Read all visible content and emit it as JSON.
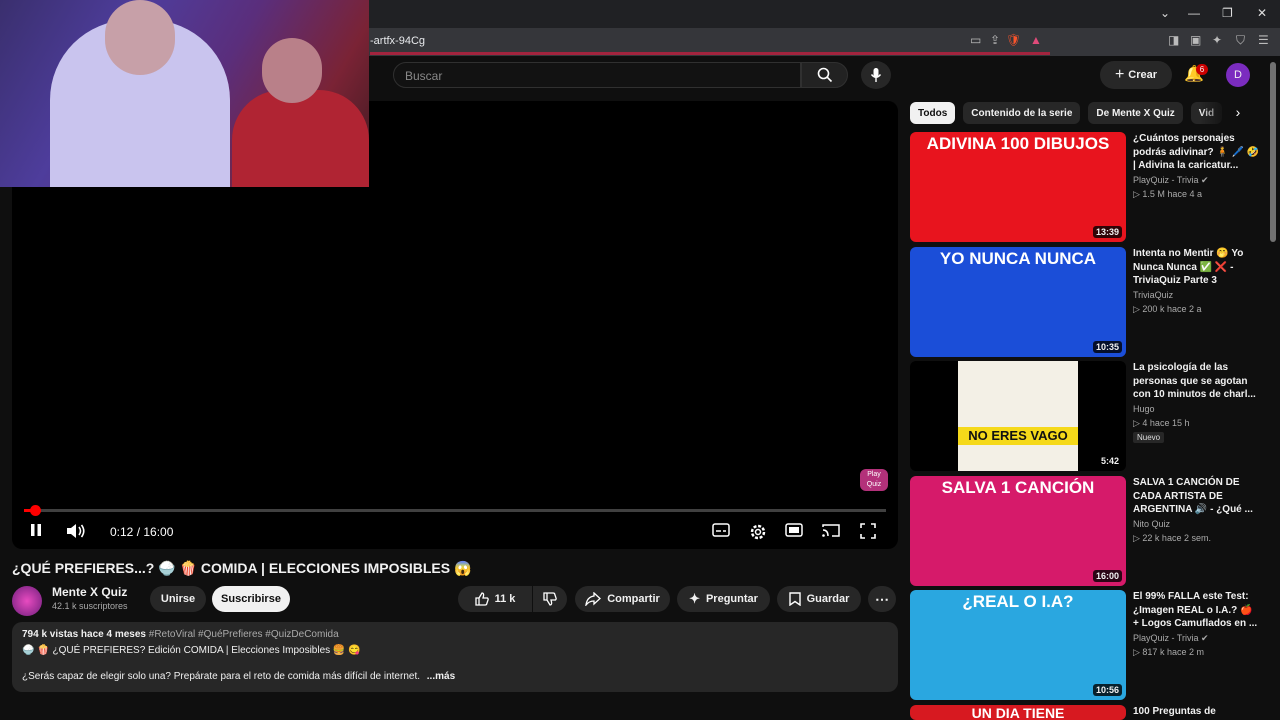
{
  "browser": {
    "url_fragment": "-artfx-94Cg"
  },
  "header": {
    "search_placeholder": "Buscar",
    "create_label": "Crear",
    "notif_count": "6",
    "avatar_letter": "D"
  },
  "player": {
    "time": "0:12 / 16:00",
    "progress_fraction": 0.0125,
    "watermark": "Play Quiz"
  },
  "video": {
    "title": "¿QUÉ PREFIERES...? 🍚 🍿 COMIDA | ELECCIONES IMPOSIBLES 😱",
    "channel": "Mente X Quiz",
    "subscribers": "42.1 k suscriptores",
    "join_label": "Unirse",
    "subscribe_label": "Suscribirse",
    "likes": "11 k",
    "share_label": "Compartir",
    "ask_label": "Preguntar",
    "save_label": "Guardar"
  },
  "description": {
    "views_date": "794 k vistas  hace 4 meses",
    "tags": "#RetoViral #QuéPrefieres #QuizDeComida",
    "line2": "🍚 🍿 ¿QUÉ PREFIERES? Edición COMIDA | Elecciones Imposibles 🍔 😋",
    "line3": "¿Serás capaz de elegir solo una? Prepárate para el reto de comida más difícil de internet.",
    "more": "...más"
  },
  "chips": [
    "Todos",
    "Contenido de la serie",
    "De Mente X Quiz",
    "Vid"
  ],
  "recommendations": [
    {
      "thumb_text": "ADIVINA 100 DIBUJOS",
      "thumb_color": "#e8141e",
      "duration": "13:39",
      "title": "¿Cuántos personajes podrás adivinar? 🧍 🖊️ 🤣 | Adivina la caricatur...",
      "channel": "PlayQuiz - Trivia ✔",
      "meta": "▷ 1.5 M   hace 4 a"
    },
    {
      "thumb_text": "YO NUNCA NUNCA",
      "thumb_color": "#1b4ed8",
      "duration": "10:35",
      "title": "Intenta no Mentir 🤭 Yo Nunca Nunca ✅ ❌ - TriviaQuiz Parte 3",
      "channel": "TriviaQuiz",
      "meta": "▷ 200 k   hace 2 a"
    },
    {
      "thumb_text": "NO ERES VAGO",
      "thumb_color": "#f3f0e6",
      "duration": "5:42",
      "title": "La psicología de las personas que se agotan con 10 minutos de charl...",
      "channel": "Hugo",
      "meta": "▷ 4   hace 15 h",
      "badge": "Nuevo"
    },
    {
      "thumb_text": "SALVA 1 CANCIÓN",
      "thumb_color": "#d61a6a",
      "duration": "16:00",
      "title": "SALVA 1 CANCIÓN DE CADA ARTISTA DE ARGENTINA 🔊 - ¿Qué ...",
      "channel": "Nito Quiz",
      "meta": "▷ 22 k   hace 2 sem."
    },
    {
      "thumb_text": "¿REAL O I.A?",
      "thumb_color": "#2aa7e0",
      "duration": "10:56",
      "title": "El 99% FALLA este Test: ¿Imagen REAL o I.A.? 🍎 + Logos Camuflados en ...",
      "channel": "PlayQuiz - Trivia ✔",
      "meta": "▷ 817 k   hace 2 m"
    },
    {
      "thumb_text": "UN DIA TIENE",
      "thumb_color": "#d71920",
      "title": "100 Preguntas de"
    }
  ]
}
